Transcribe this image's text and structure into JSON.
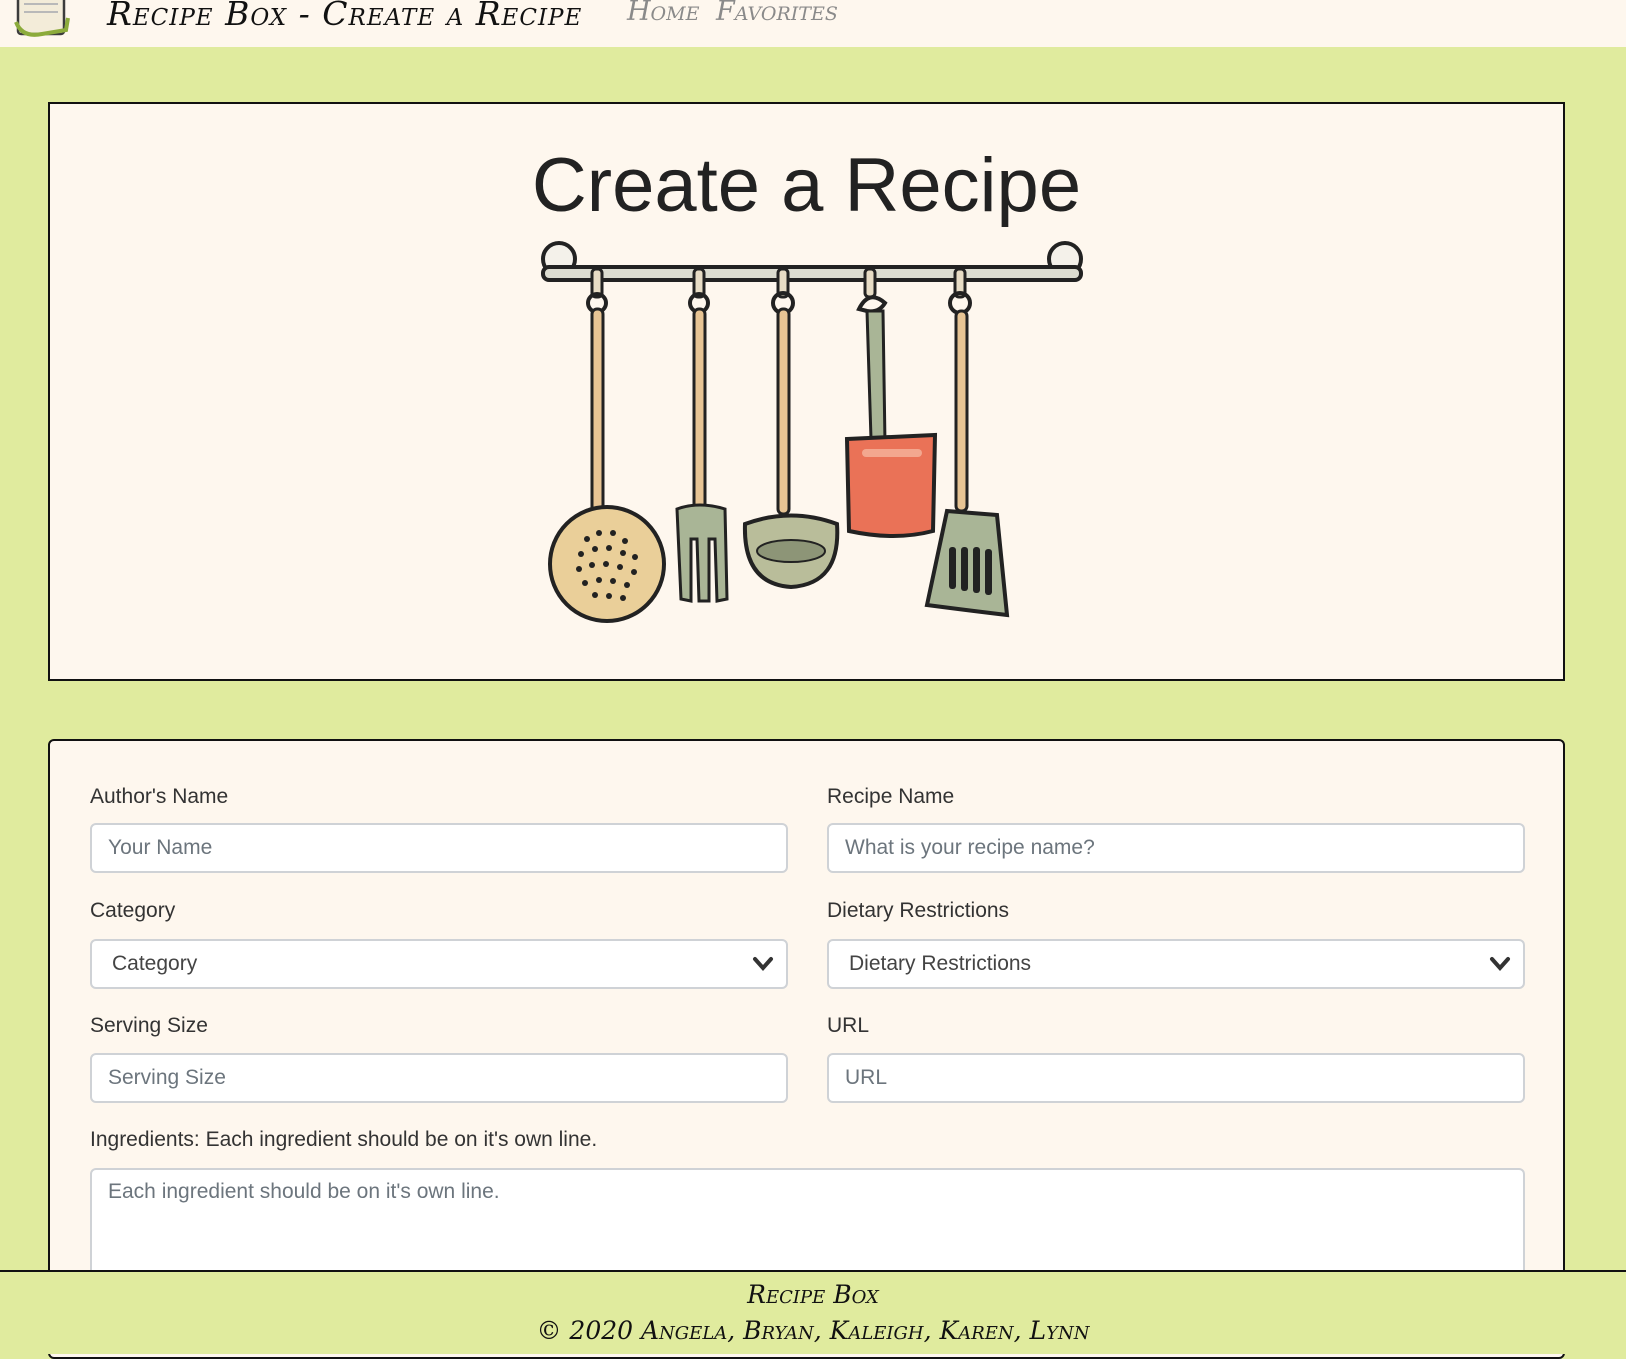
{
  "navbar": {
    "logo_icon": "recipe-clipboard-icon",
    "title": "Recipe Box - Create a Recipe",
    "links": [
      {
        "label": "Home"
      },
      {
        "label": "Favorites"
      }
    ]
  },
  "hero": {
    "title": "Create a Recipe",
    "image_icon": "kitchen-utensils-illustration"
  },
  "form": {
    "author": {
      "label": "Author's Name",
      "placeholder": "Your Name"
    },
    "recipe_name": {
      "label": "Recipe Name",
      "placeholder": "What is your recipe name?"
    },
    "category": {
      "label": "Category",
      "selected": "Category"
    },
    "dietary": {
      "label": "Dietary Restrictions",
      "selected": "Dietary Restrictions"
    },
    "serving": {
      "label": "Serving Size",
      "placeholder": "Serving Size"
    },
    "url": {
      "label": "URL",
      "placeholder": "URL"
    },
    "ingredients": {
      "label": "Ingredients: Each ingredient should be on it's own line.",
      "placeholder": "Each ingredient should be on it's own line."
    }
  },
  "footer": {
    "title": "Recipe Box",
    "credits": "© 2020 Angela, Bryan, Kaleigh, Karen, Lynn"
  },
  "colors": {
    "page_background": "#e0eb9e",
    "card_background": "#fef7ee",
    "border": "#111111",
    "nav_link": "#8a8a8a"
  }
}
